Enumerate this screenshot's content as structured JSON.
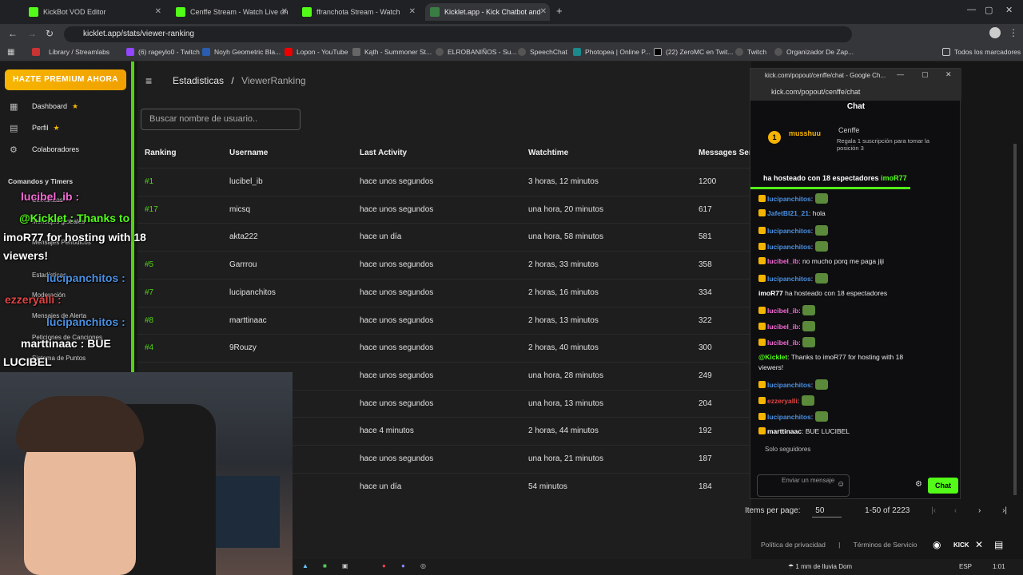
{
  "browser": {
    "tabs": [
      {
        "label": "KickBot VOD Editor",
        "color": "#53fc18"
      },
      {
        "label": "Cenffe Stream - Watch Live on",
        "color": "#53fc18"
      },
      {
        "label": "ffranchota Stream - Watch",
        "color": "#53fc18"
      },
      {
        "label": "Kicklet.app - Kick Chatbot and",
        "color": "#3a7d44"
      }
    ],
    "url": "kicklet.app/stats/viewer-ranking",
    "bookmarks": [
      "Library / Streamlabs",
      "(6) rageylo0 - Twitch",
      "Noyh Geometric Bla...",
      "Lopon - YouTube",
      "Kąth - Summoner St...",
      "ELROBANIÑOS - Su...",
      "SpeechChat",
      "Photopea | Online P...",
      "(22) ZeroMC en Twit...",
      "Twitch",
      "Organizador De Zap..."
    ],
    "all_bookmarks": "Todos los marcadores"
  },
  "sidebar": {
    "premium": "HAZTE PREMIUM AHORA",
    "items": [
      "Dashboard",
      "Perfil",
      "Colaboradores"
    ],
    "section": "Comandos y Timers",
    "sub_items": [
      "Comandos",
      "Mensajes globales",
      "Mensajes Periodicos",
      "Estadísticas",
      "Moderación",
      "Mensajes de Alerta",
      "Peticiones de Canciones",
      "Sistema de Puntos"
    ]
  },
  "header": {
    "crumb1": "Estadisticas",
    "sep": "/",
    "crumb2": "ViewerRanking"
  },
  "search": {
    "placeholder": "Buscar nombre de usuario.."
  },
  "table": {
    "headers": [
      "Ranking",
      "Username",
      "Last Activity",
      "Watchtime",
      "Messages Ser"
    ],
    "rows": [
      [
        "#1",
        "lucibel_ib",
        "hace unos segundos",
        "3 horas, 12 minutos",
        "1200"
      ],
      [
        "#17",
        "micsq",
        "hace unos segundos",
        "una hora, 20 minutos",
        "617"
      ],
      [
        "",
        "akta222",
        "hace un día",
        "una hora, 58 minutos",
        "581"
      ],
      [
        "#5",
        "Garrrou",
        "hace unos segundos",
        "2 horas, 33 minutos",
        "358"
      ],
      [
        "#7",
        "lucipanchitos",
        "hace unos segundos",
        "2 horas, 16 minutos",
        "334"
      ],
      [
        "#8",
        "marttinaac",
        "hace unos segundos",
        "2 horas, 13 minutos",
        "322"
      ],
      [
        "#4",
        "9Rouzy",
        "hace unos segundos",
        "2 horas, 40 minutos",
        "300"
      ],
      [
        "",
        "",
        "hace unos segundos",
        "una hora, 28 minutos",
        "249"
      ],
      [
        "",
        "",
        "hace unos segundos",
        "una hora, 13 minutos",
        "204"
      ],
      [
        "",
        "",
        "hace 4 minutos",
        "2 horas, 44 minutos",
        "192"
      ],
      [
        "",
        "",
        "hace unos segundos",
        "una hora, 21 minutos",
        "187"
      ],
      [
        "",
        "",
        "hace un día",
        "54 minutos",
        "184"
      ]
    ]
  },
  "overlay": {
    "l1": "lucibel_ib :",
    "l2": "@Kicklet : Thanks to",
    "l3": "imoR77 for hosting with 18",
    "l4": "viewers!",
    "l5": "lucipanchitos :",
    "l6": "ezzeryalli :",
    "l7": "lucipanchitos :",
    "l8": "marttinaac : BUE",
    "l9": "LUCIBEL"
  },
  "popup": {
    "title": "kick.com/popout/cenffe/chat - Google Ch...",
    "url": "kick.com/popout/cenffe/chat",
    "chat_header": "Chat",
    "pinned_user": "musshuu",
    "pinned_count": "1",
    "pinned_channel": "Cenffe",
    "pinned_text": "Regala 1 suscripción para tomar la posición 3",
    "host_banner": "ha hosteado con 18 espectadores",
    "host_user": "imoR77",
    "messages": [
      {
        "u": "lucipanchitos",
        "t": "",
        "c": "#4a90e2"
      },
      {
        "u": "JafetBl21_21",
        "t": "hola",
        "c": "#4a90e2"
      },
      {
        "u": "lucipanchitos",
        "t": "",
        "c": "#4a90e2"
      },
      {
        "u": "lucipanchitos",
        "t": "",
        "c": "#4a90e2"
      },
      {
        "u": "lucibel_ib",
        "t": "no mucho porq me paga jiji",
        "c": "#f46ad6"
      },
      {
        "u": "lucipanchitos",
        "t": "",
        "c": "#4a90e2"
      },
      {
        "u": "imoR77",
        "t": "ha hosteado con 18 espectadores",
        "c": "#ffffff"
      },
      {
        "u": "lucibel_ib",
        "t": "",
        "c": "#f46ad6"
      },
      {
        "u": "lucibel_ib",
        "t": "",
        "c": "#f46ad6"
      },
      {
        "u": "lucibel_ib",
        "t": "",
        "c": "#f46ad6"
      },
      {
        "u": "@Kicklet",
        "t": "Thanks to imoR77 for hosting with 18",
        "c": "#53fc18"
      },
      {
        "u": "",
        "t": "viewers!",
        "c": "#ffffff"
      },
      {
        "u": "lucipanchitos",
        "t": "",
        "c": "#4a90e2"
      },
      {
        "u": "ezzeryalli",
        "t": "",
        "c": "#e04545"
      },
      {
        "u": "lucipanchitos",
        "t": "",
        "c": "#4a90e2"
      },
      {
        "u": "marttinaac",
        "t": "BUE LUCIBEL",
        "c": "#ffffff"
      }
    ],
    "followers_only": "Solo seguidores",
    "input_placeholder": "Enviar un mensaje",
    "send": "Chat"
  },
  "pager": {
    "label": "Items per page:",
    "value": "50",
    "range": "1-50 of 2223"
  },
  "footer": {
    "privacy": "Política de privacidad",
    "sep": "|",
    "terms": "Términos de Servicio"
  },
  "taskbar": {
    "weather": "1 mm de lluvia Dom",
    "lang": "ESP",
    "time": "1:01"
  }
}
